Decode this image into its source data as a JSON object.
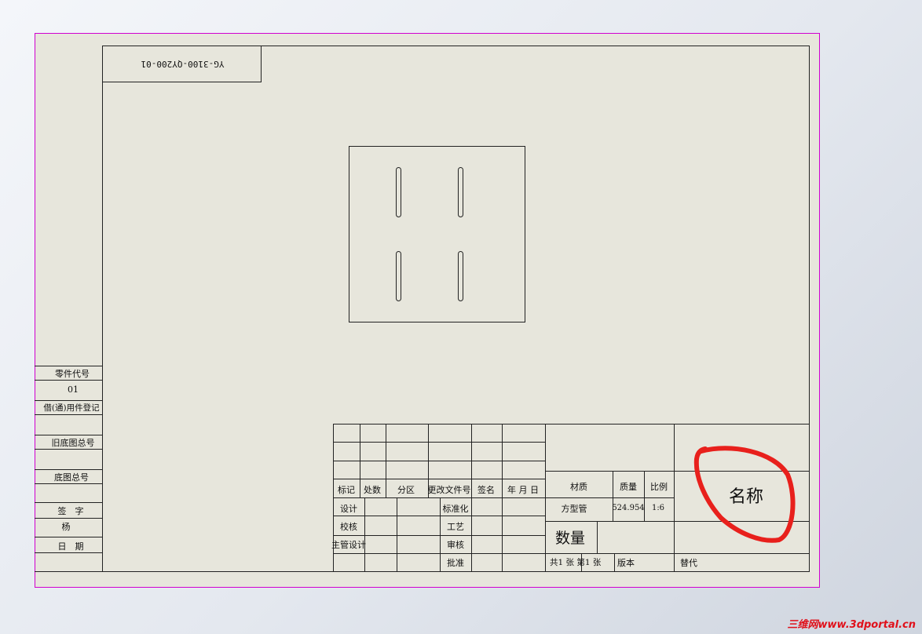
{
  "drawing": {
    "top_code": "YG-3100-QY200-01",
    "left_strip": {
      "part_code_label": "零件代号",
      "part_code_value": "01",
      "borrowed_label": "借(通)用件登记",
      "old_base_label": "旧底图总号",
      "base_label": "底图总号",
      "sign_label": "签　字",
      "sign_value": "杨",
      "date_label": "日　期"
    },
    "title_block": {
      "mark": "标记",
      "count": "处数",
      "zone": "分区",
      "change_doc": "更改文件号",
      "signature": "签名",
      "ymd": "年 月 日",
      "design": "设计",
      "standardize": "标准化",
      "check": "校核",
      "process": "工艺",
      "chief_design": "主管设计",
      "review": "审核",
      "approve": "批准",
      "material_label": "材质",
      "mass_label": "质量",
      "scale_label": "比例",
      "material_value": "方型管",
      "mass_value": "524.954",
      "scale_value": "1:6",
      "quantity": "数量",
      "sheets": "共1 张  第1 张",
      "version": "版本",
      "replace": "替代",
      "name": "名称"
    }
  },
  "annotation": {
    "color": "#e8201c"
  },
  "watermark": "三维网www.3dportal.cn"
}
